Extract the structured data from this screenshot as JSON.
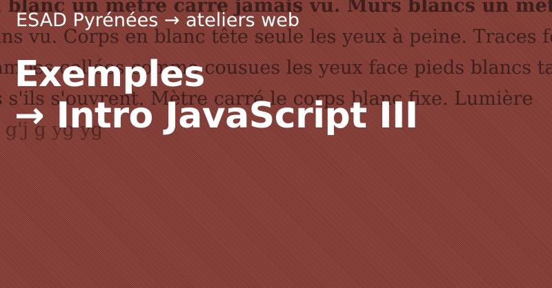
{
  "background": {
    "base_color": "#8a3a32",
    "text_color": "#2a0f0c",
    "lines": [
      "l blanc un mètre carré jamais vu. Murs blancs un mètre sur",
      "ans vu. Corps en blanc tête seule les yeux à peine. Traces fo",
      "Jambes collées comme cousues les yeux face pieds blancs tal",
      "s s'ils s'ouvrent. Mètre carré le corps blanc fixe. Lumière",
      "g g'j g yg yg"
    ]
  },
  "header": {
    "text": "ESAD Pyrénées → ateliers web"
  },
  "title": {
    "line1": "Exemples",
    "line2": "→ Intro JavaScript III"
  },
  "colors": {
    "foreground": "#ffffff"
  }
}
